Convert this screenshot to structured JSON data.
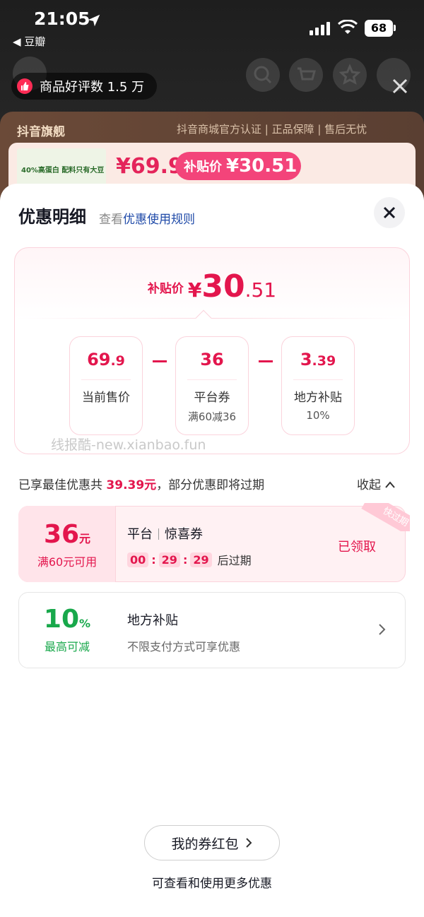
{
  "status_bar": {
    "time": "21:05",
    "back_app": "豆瓣",
    "battery": "68"
  },
  "toast": {
    "text": "商品好评数 1.5 万"
  },
  "shop": {
    "title": "抖音旗舰",
    "badges": "抖音商城官方认证 | 正品保障 | 售后无忧",
    "product_banner_text": "40%高蛋白 配料只有大豆",
    "price": "¥69.9",
    "subsidy_label": "补贴价",
    "subsidy_price": "¥30.51"
  },
  "sheet": {
    "title": "优惠明细",
    "view_prefix": "查看",
    "rules_link": "优惠使用规则",
    "final_label": "补贴价",
    "final_yen": "¥",
    "final_int": "30",
    "final_dec": ".51",
    "boxes": [
      {
        "int": "69",
        "dec": ".9",
        "label": "当前售价",
        "sub": ""
      },
      {
        "int": "36",
        "dec": "",
        "label": "平台券",
        "sub": "满60减36"
      },
      {
        "int": "3",
        "dec": ".39",
        "label": "地方补贴",
        "sub": "10%"
      }
    ],
    "watermark": "线报酷-new.xianbao.fun",
    "summary_prefix": "已享最佳优惠共",
    "summary_amount": "39.39元",
    "summary_suffix": "，部分优惠即将过期",
    "collapse_label": "收起"
  },
  "coupons": [
    {
      "amount": "36",
      "unit": "元",
      "condition": "满60元可用",
      "source": "平台",
      "name": "惊喜券",
      "timer": {
        "h": "00",
        "m": "29",
        "s": "29",
        "suffix": "后过期"
      },
      "status": "已领取",
      "ribbon": "快过期"
    },
    {
      "amount": "10",
      "unit": "%",
      "condition": "最高可减",
      "name": "地方补贴",
      "desc": "不限支付方式可享优惠"
    }
  ],
  "wallet": {
    "button": "我的券红包",
    "hint": "可查看和使用更多优惠"
  },
  "colors": {
    "accent": "#e3164d",
    "green": "#18a84b",
    "link": "#1f4aa8"
  }
}
